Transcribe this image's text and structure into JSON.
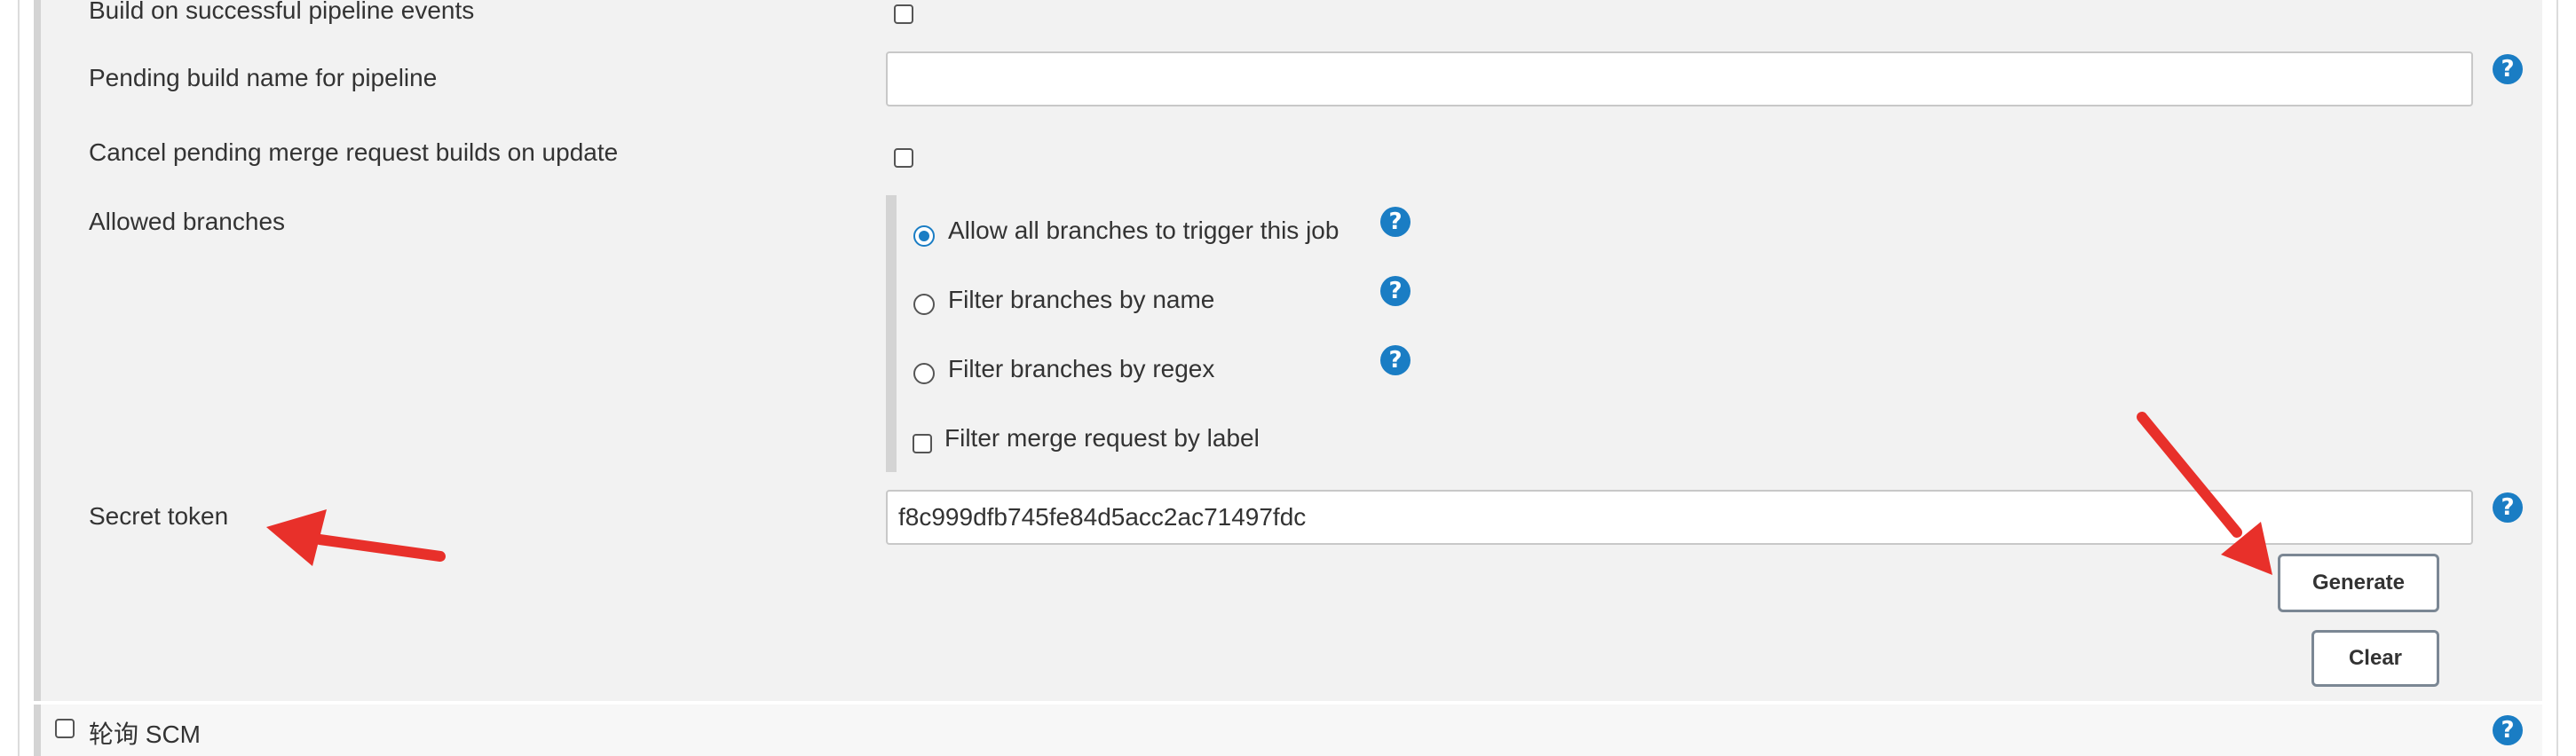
{
  "form": {
    "build_on_pipeline_label": "Build on successful pipeline events",
    "pending_build_name_label": "Pending build name for pipeline",
    "pending_build_name_value": "",
    "cancel_pending_label": "Cancel pending merge request builds on update",
    "allowed_branches_label": "Allowed branches",
    "branch_options": [
      {
        "label": "Allow all branches to trigger this job",
        "selected": true
      },
      {
        "label": "Filter branches by name",
        "selected": false
      },
      {
        "label": "Filter branches by regex",
        "selected": false
      }
    ],
    "filter_mr_by_label": "Filter merge request by label",
    "secret_token_label": "Secret token",
    "secret_token_value": "f8c999dfb745fe84d5acc2ac71497fdc",
    "generate_button": "Generate",
    "clear_button": "Clear",
    "poll_scm_label": "轮询 SCM"
  },
  "icons": {
    "help": "?"
  },
  "colors": {
    "help_icon": "#1a7dc4",
    "annotation_arrow": "#e8302a",
    "panel_bg": "#f2f2f2"
  }
}
